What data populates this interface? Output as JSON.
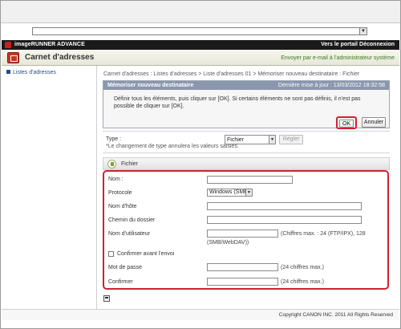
{
  "header": {
    "brand": "imageRUNNER ADVANCE",
    "portal_link": "Vers le portail",
    "logout_link": "Déconnexion"
  },
  "title_bar": {
    "title": "Carnet d'adresses",
    "email_admin": "Envoyer par e-mail à l'administrateur système"
  },
  "sidebar": {
    "items": [
      {
        "label": "Listes d'adresses"
      }
    ]
  },
  "breadcrumb": "Carnet d'adresses : Listes d'adresses > Liste d'adresses 01 > Mémoriser nouveau destinataire : Fichier",
  "memo": {
    "title": "Mémoriser nouveau destinataire",
    "last_update": "Dernière mise à jour : 13/03/2012 18:32:58",
    "instructions": "Définir tous les éléments, puis cliquer sur [OK]. Si certains éléments ne sont pas définis, il n'est pas possible de cliquer sur [OK].",
    "ok_label": "OK",
    "cancel_label": "Annuler"
  },
  "type_section": {
    "label": "Type :",
    "selected": "Fichier",
    "regler_label": "Régler",
    "note": "*Le changement de type annulera les valeurs saisies."
  },
  "fichier_section": {
    "title": "Fichier",
    "fields": {
      "nom_label": "Nom :",
      "protocole_label": "Protocole",
      "protocole_value": "Windows (SMB)",
      "nom_hote_label": "Nom d'hôte",
      "chemin_label": "Chemin du dossier",
      "utilisateur_label": "Nom d'utilisateur",
      "utilisateur_hint_line1": "(Chiffres max. : 24 (FTP/IPX), 128",
      "utilisateur_hint_line2": "(SMB/WebDAV))",
      "confirmer_envoi_label": "Confirmer avant l'envoi",
      "mot_de_passe_label": "Mot de passe",
      "mot_de_passe_hint": "(24 chiffres max.)",
      "confirmer_label": "Confirmer",
      "confirmer_hint": "(24 chiffres max.)"
    }
  },
  "footer": {
    "copyright": "Copyright CANON INC. 2011 All Rights Reserved"
  }
}
